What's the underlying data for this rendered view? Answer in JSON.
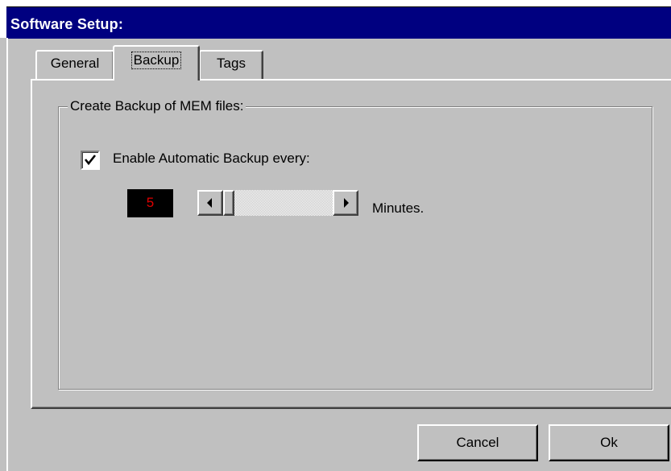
{
  "window": {
    "title": "Software Setup:"
  },
  "tabs": [
    {
      "label": "General",
      "selected": false
    },
    {
      "label": "Backup",
      "selected": true
    },
    {
      "label": "Tags",
      "selected": false
    }
  ],
  "backup_group": {
    "legend": "Create Backup of MEM files:",
    "auto_backup": {
      "label": "Enable Automatic Backup every:",
      "checked": true
    },
    "interval": {
      "value": "5",
      "unit_label": "Minutes.",
      "slider_value": 5
    }
  },
  "buttons": {
    "cancel": "Cancel",
    "ok": "Ok"
  },
  "colors": {
    "title_bar": "#000080",
    "face": "#c0c0c0",
    "led_background": "#000000",
    "led_digit": "#e00000"
  }
}
